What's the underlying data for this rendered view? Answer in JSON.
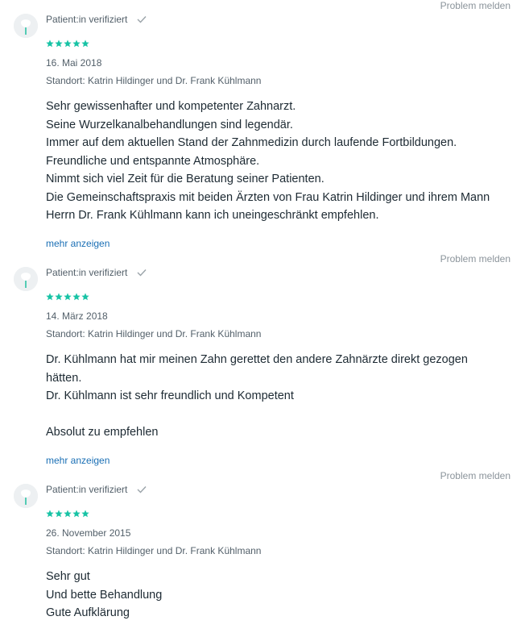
{
  "colors": {
    "star": "#17c3a5",
    "link": "#1a6fb5",
    "muted": "#8b949b",
    "text": "#1d2a33"
  },
  "reviews": [
    {
      "report_label": "Problem melden",
      "verified_label": "Patient:in verifiziert",
      "rating": 5,
      "date": "16. Mai 2018",
      "location": "Standort: Katrin Hildinger und Dr. Frank Kühlmann",
      "lines": [
        "Sehr gewissenhafter und kompetenter Zahnarzt.",
        "Seine Wurzelkanalbehandlungen sind legendär.",
        "Immer auf dem aktuellen Stand der Zahnmedizin durch laufende Fortbildungen.",
        "Freundliche und entspannte Atmosphäre.",
        "Nimmt sich viel Zeit für die Beratung seiner Patienten.",
        "Die Gemeinschaftspraxis mit beiden Ärzten von Frau Katrin Hildinger und ihrem Mann",
        "Herrn Dr. Frank Kühlmann kann ich uneingeschränkt empfehlen."
      ],
      "more_label": "mehr anzeigen"
    },
    {
      "report_label": "Problem melden",
      "verified_label": "Patient:in verifiziert",
      "rating": 5,
      "date": "14. März 2018",
      "location": "Standort: Katrin Hildinger und Dr. Frank Kühlmann",
      "lines": [
        "Dr. Kühlmann hat mir meinen Zahn gerettet den andere Zahnärzte direkt gezogen",
        "hätten.",
        "Dr. Kühlmann ist sehr freundlich und Kompetent",
        "",
        "Absolut zu empfehlen"
      ],
      "more_label": "mehr anzeigen"
    },
    {
      "report_label": "Problem melden",
      "verified_label": "Patient:in verifiziert",
      "rating": 5,
      "date": "26. November 2015",
      "location": "Standort: Katrin Hildinger und Dr. Frank Kühlmann",
      "lines": [
        "Sehr gut",
        "Und bette Behandlung",
        "Gute Aufklärung"
      ]
    }
  ]
}
